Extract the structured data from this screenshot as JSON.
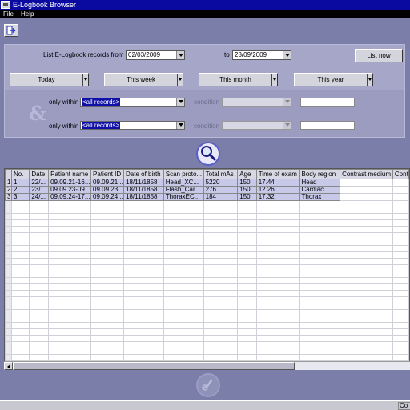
{
  "window": {
    "title": "E-Logbook Browser"
  },
  "menu": [
    {
      "label": "File"
    },
    {
      "label": "Help"
    }
  ],
  "filter": {
    "list_label": "List E-Logbook records from",
    "from_date": "02/03/2009",
    "to_label": "to",
    "to_date": "28/09/2009",
    "list_now_label": "List now",
    "quick": [
      {
        "label": "Today"
      },
      {
        "label": "This week"
      },
      {
        "label": "This month"
      },
      {
        "label": "This year"
      }
    ],
    "and_symbol": "&",
    "conditions": [
      {
        "label": "only within",
        "field": "<all records>",
        "condition_label": "condition",
        "condition_value": "",
        "value": ""
      },
      {
        "label": "only within",
        "field": "<all records>",
        "condition_label": "condition",
        "condition_value": "",
        "value": ""
      }
    ]
  },
  "table": {
    "columns": [
      "",
      "No.",
      "Date",
      "Patient name",
      "Patient ID",
      "Date of birth",
      "Scan proto...",
      "Total mAs",
      "Age",
      "Time of exam",
      "Body region",
      "Contrast medium",
      "Cont"
    ],
    "rows": [
      [
        "1",
        "1",
        "22/...",
        "09.09.21-16...",
        "09.09.21...",
        "18/11/1858",
        "Head_XC...",
        "5220",
        "150",
        "17.44",
        "Head",
        "",
        ""
      ],
      [
        "2",
        "2",
        "23/...",
        "09.09.23-09...",
        "09.09.23...",
        "18/11/1858",
        "Flash_Car...",
        "276",
        "150",
        "12.26",
        "Cardiac",
        "",
        ""
      ],
      [
        "3",
        "3",
        "24/...",
        "09.09.24-17...",
        "09.09.24...",
        "18/11/1858",
        "ThoraxEC...",
        "184",
        "150",
        "17.32",
        "Thorax",
        "",
        ""
      ]
    ],
    "empty_rows": 28
  },
  "status": {
    "text": "Co"
  },
  "icons": {
    "exit": "exit-icon",
    "search": "magnifier-icon",
    "logo": "logbook-logo-icon"
  }
}
